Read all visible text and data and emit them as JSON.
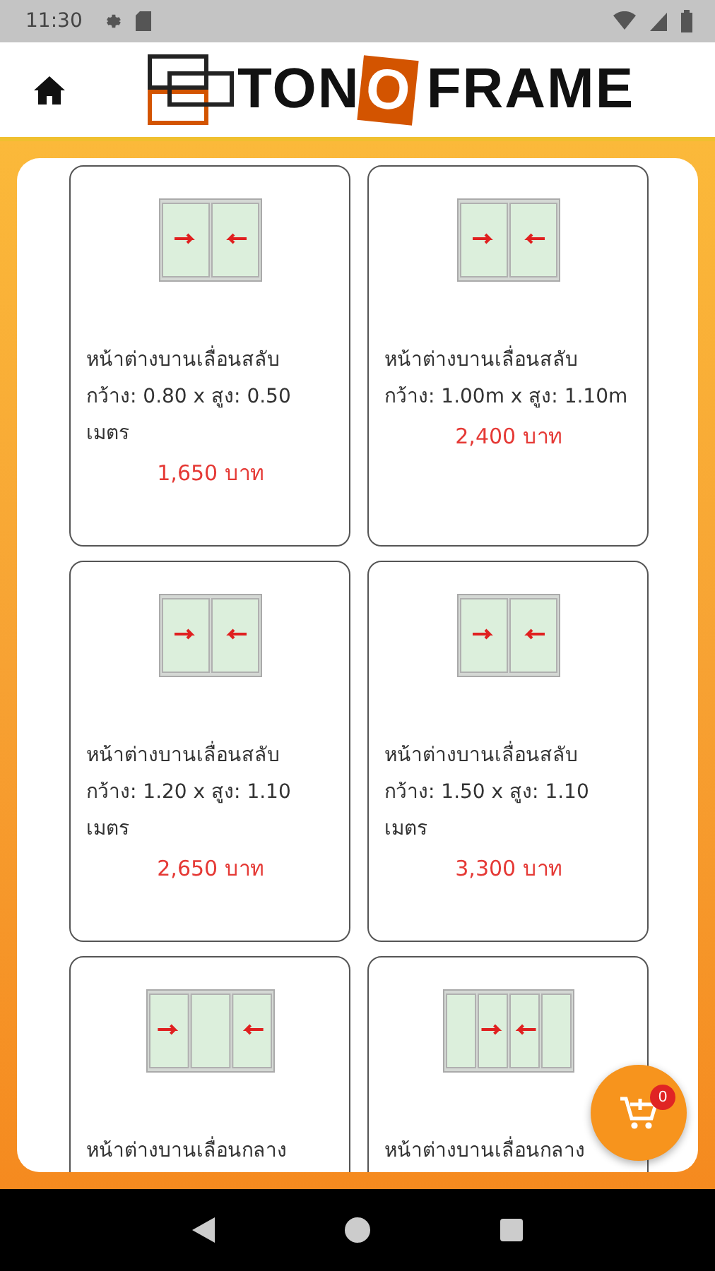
{
  "status_bar": {
    "time": "11:30"
  },
  "header": {
    "logo": {
      "text_before": "TON",
      "highlight": "O",
      "text_after": "FRAME"
    }
  },
  "products": [
    {
      "kind": "two-pane",
      "title": "หน้าต่างบานเลื่อนสลับ",
      "size": "กว้าง: 0.80 x สูง: 0.50 เมตร",
      "price": "1,650 บาท"
    },
    {
      "kind": "two-pane",
      "title": "หน้าต่างบานเลื่อนสลับ",
      "size": "กว้าง: 1.00m x สูง: 1.10m",
      "price": "2,400 บาท"
    },
    {
      "kind": "two-pane",
      "title": "หน้าต่างบานเลื่อนสลับ",
      "size": "กว้าง: 1.20 x สูง: 1.10 เมตร",
      "price": "2,650 บาท"
    },
    {
      "kind": "two-pane",
      "title": "หน้าต่างบานเลื่อนสลับ",
      "size": "กว้าง: 1.50 x สูง: 1.10 เมตร",
      "price": "3,300 บาท"
    },
    {
      "kind": "three-pane",
      "title": "หน้าต่างบานเลื่อนกลาง"
    },
    {
      "kind": "four-pane",
      "title": "หน้าต่างบานเลื่อนกลาง"
    }
  ],
  "cart": {
    "count": "0"
  }
}
